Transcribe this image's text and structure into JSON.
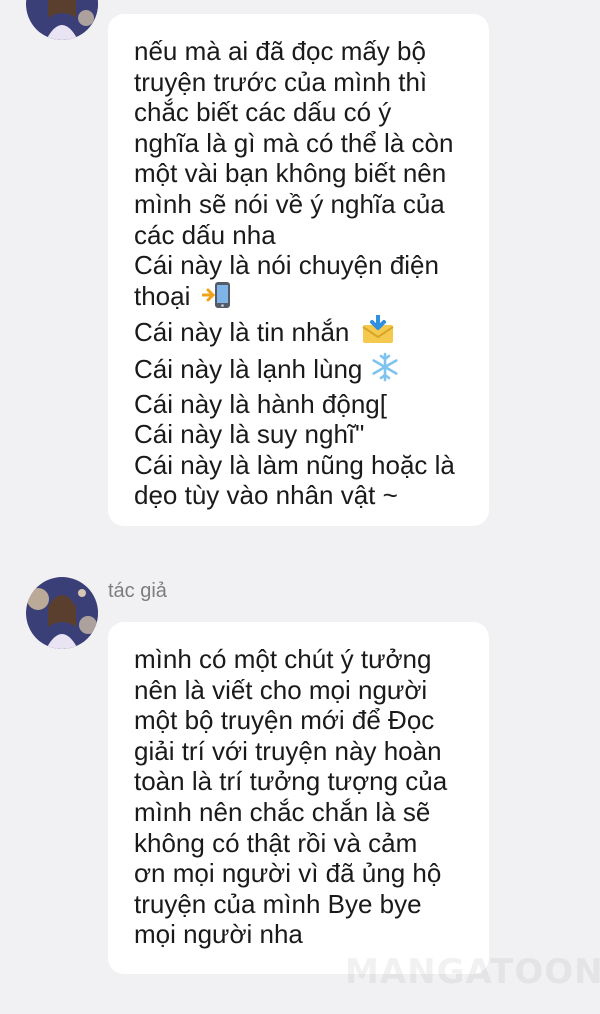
{
  "messages": [
    {
      "lines": [
        "nếu mà ai đã đọc mấy bộ",
        "truyện trước của mình thì",
        "chắc biết các dấu có ý",
        "nghĩa là gì mà có thể là còn",
        "một vài bạn không biết nên",
        "mình sẽ nói về ý nghĩa của",
        "các dấu nha",
        "Cái này là nói chuyện điện",
        "thoại",
        "Cái này là tin nhắn",
        "Cái này là lạnh lùng",
        "Cái này là hành động[",
        "Cái này là suy nghĩ\"",
        "Cái này là làm nũng hoặc là",
        "dẹo tùy vào nhân vật ~"
      ],
      "emojis": {
        "line_8": "phone-icon",
        "line_9": "envelope-icon",
        "line_10": "snowflake-icon"
      }
    },
    {
      "author": "tác giả",
      "lines": [
        "mình có một chút ý tưởng",
        "nên là viết cho mọi người",
        "một bộ truyện mới để Đọc",
        "giải trí với truyện này hoàn",
        "toàn là trí tưởng tượng của",
        "mình nên chắc chắn là sẽ",
        "không có thật rồi và cảm",
        "ơn mọi người vì đã ủng hộ",
        "truyện của mình Bye bye",
        "mọi người nha"
      ]
    }
  ],
  "watermark": "MANGATOON",
  "colors": {
    "background": "#f1f1f3",
    "bubble": "#ffffff",
    "text": "#1a1a1a",
    "author": "#7d7d7d"
  }
}
